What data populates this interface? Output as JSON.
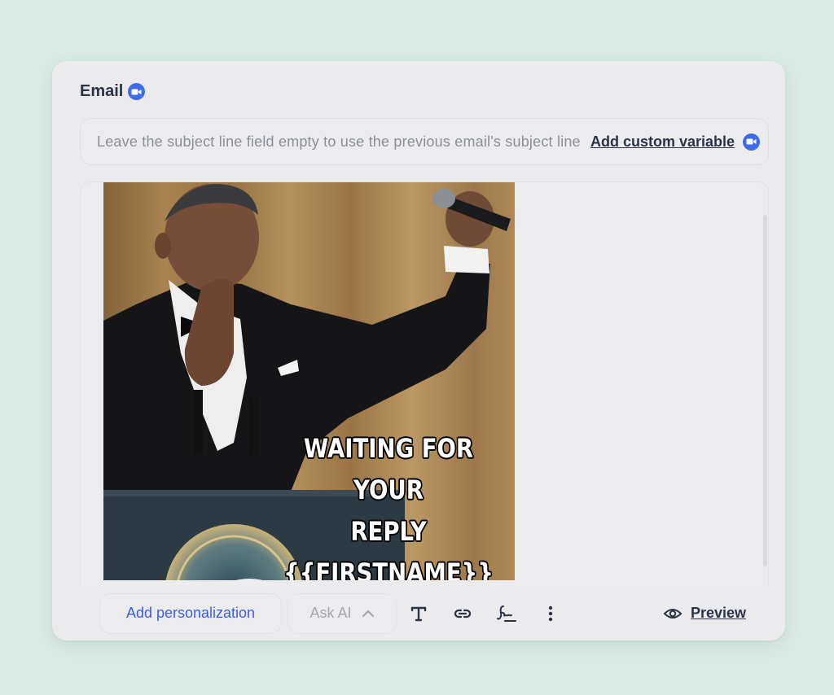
{
  "email_card": {
    "title": "Email",
    "subject": {
      "value": "",
      "placeholder": "Leave the subject line field empty to use the previous email's subject line",
      "custom_variable_label": "Add custom variable"
    },
    "body": {
      "meme_caption_line1": "WAITING FOR YOUR",
      "meme_caption_line2": "REPLY",
      "meme_caption_line3": "{{FIRSTNAME}}"
    },
    "toolbar": {
      "add_personalization_label": "Add personalization",
      "ask_ai_label": "Ask AI",
      "preview_label": "Preview"
    }
  },
  "colors": {
    "page_background": "#daebe5",
    "card_background": "#ebebee",
    "accent_blue": "#3e6be8",
    "heading_text": "#2a3446",
    "muted_text": "#8a8f99"
  },
  "icons": {
    "title_badge": "video-camera-icon",
    "subject_badge": "video-camera-icon",
    "avatar_button": "user-circle-icon",
    "ask_ai_toggle": "chevron-up-icon",
    "text_format": "text-format-icon",
    "link": "link-icon",
    "signature": "signature-icon",
    "more": "more-vertical-icon",
    "preview": "eye-icon"
  }
}
